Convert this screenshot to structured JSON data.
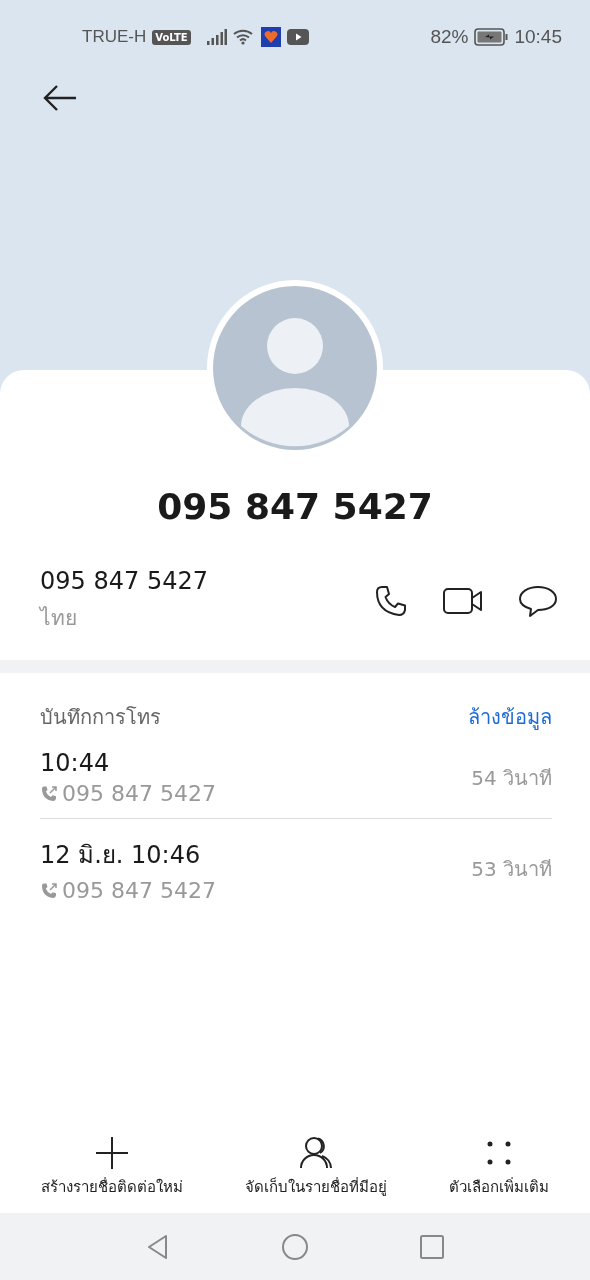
{
  "status_bar": {
    "carrier": "TRUE-H",
    "volte": "VoLTE",
    "battery_percent": "82%",
    "time": "10:45"
  },
  "contact": {
    "title": "095 847 5427",
    "number": "095 847 5427",
    "number_label": "ไทย"
  },
  "call_log": {
    "title": "บันทึกการโทร",
    "clear": "ล้างข้อมูล",
    "entries": [
      {
        "time": "10:44",
        "number": "095 847 5427",
        "duration": "54 วินาที"
      },
      {
        "time": "12 มิ.ย. 10:46",
        "number": "095 847 5427",
        "duration": "53 วินาที"
      }
    ]
  },
  "actions": [
    {
      "kind": "add",
      "label": "สร้างรายชื่อติดต่อใหม่"
    },
    {
      "kind": "person",
      "label": "จัดเก็บในรายชื่อที่มีอยู่"
    },
    {
      "kind": "more",
      "label": "ตัวเลือกเพิ่มเติม"
    }
  ]
}
